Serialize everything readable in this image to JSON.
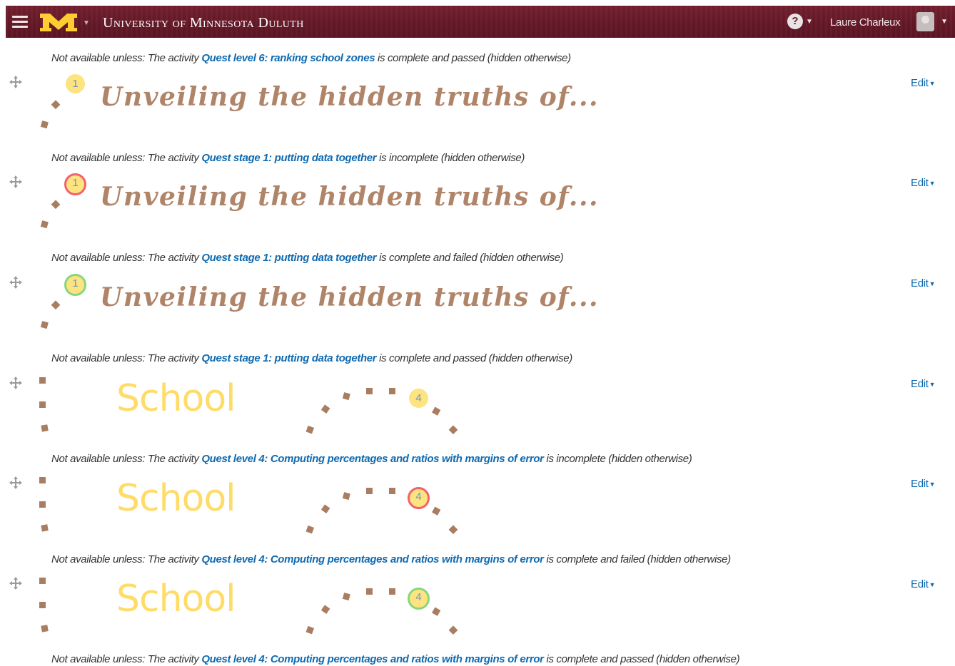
{
  "navbar": {
    "brand": "University of Minnesota Duluth",
    "user_name": "Laure Charleux",
    "colors": {
      "background": "#6c1d2b",
      "logo_gold": "#ffcc33"
    }
  },
  "sections": [
    {
      "restriction": {
        "prefix": "Not available unless: The activity ",
        "activity": "Quest level 6: ranking school zones",
        "suffix": " is complete and passed (hidden otherwise)"
      }
    },
    {
      "title": "Unveiling the hidden truths of...",
      "badge": "1",
      "badge_state": "default",
      "edit": "Edit",
      "restriction": {
        "prefix": "Not available unless: The activity ",
        "activity": "Quest stage 1: putting data together",
        "suffix": " is incomplete (hidden otherwise)"
      }
    },
    {
      "title": "Unveiling the hidden truths of...",
      "badge": "1",
      "badge_state": "red",
      "edit": "Edit",
      "restriction": {
        "prefix": "Not available unless: The activity ",
        "activity": "Quest stage 1: putting data together",
        "suffix": " is complete and failed (hidden otherwise)"
      }
    },
    {
      "title": "Unveiling the hidden truths of...",
      "badge": "1",
      "badge_state": "green",
      "edit": "Edit",
      "restriction": {
        "prefix": "Not available unless: The activity ",
        "activity": "Quest stage 1: putting data together",
        "suffix": " is complete and passed (hidden otherwise)"
      }
    },
    {
      "title": "School",
      "badge": "4",
      "badge_state": "default",
      "edit": "Edit",
      "restriction": {
        "prefix": "Not available unless: The activity ",
        "activity": "Quest level 4: Computing percentages and ratios with margins of error",
        "suffix": " is incomplete (hidden otherwise)"
      }
    },
    {
      "title": "School",
      "badge": "4",
      "badge_state": "red",
      "edit": "Edit",
      "restriction": {
        "prefix": "Not available unless: The activity ",
        "activity": "Quest level 4: Computing percentages and ratios with margins of error",
        "suffix": " is complete and failed (hidden otherwise)"
      }
    },
    {
      "title": "School",
      "badge": "4",
      "badge_state": "green",
      "edit": "Edit",
      "restriction": {
        "prefix": "Not available unless: The activity ",
        "activity": "Quest level 4: Computing percentages and ratios with margins of error",
        "suffix": " is complete and passed (hidden otherwise)"
      }
    }
  ],
  "colors": {
    "link": "#0f6ab0",
    "quest_title": "#b08468",
    "school_title": "#fedc67",
    "badge_fill": "#fee381",
    "badge_red": "#f1626b",
    "badge_green": "#88d67c",
    "dot": "#a87d62"
  }
}
